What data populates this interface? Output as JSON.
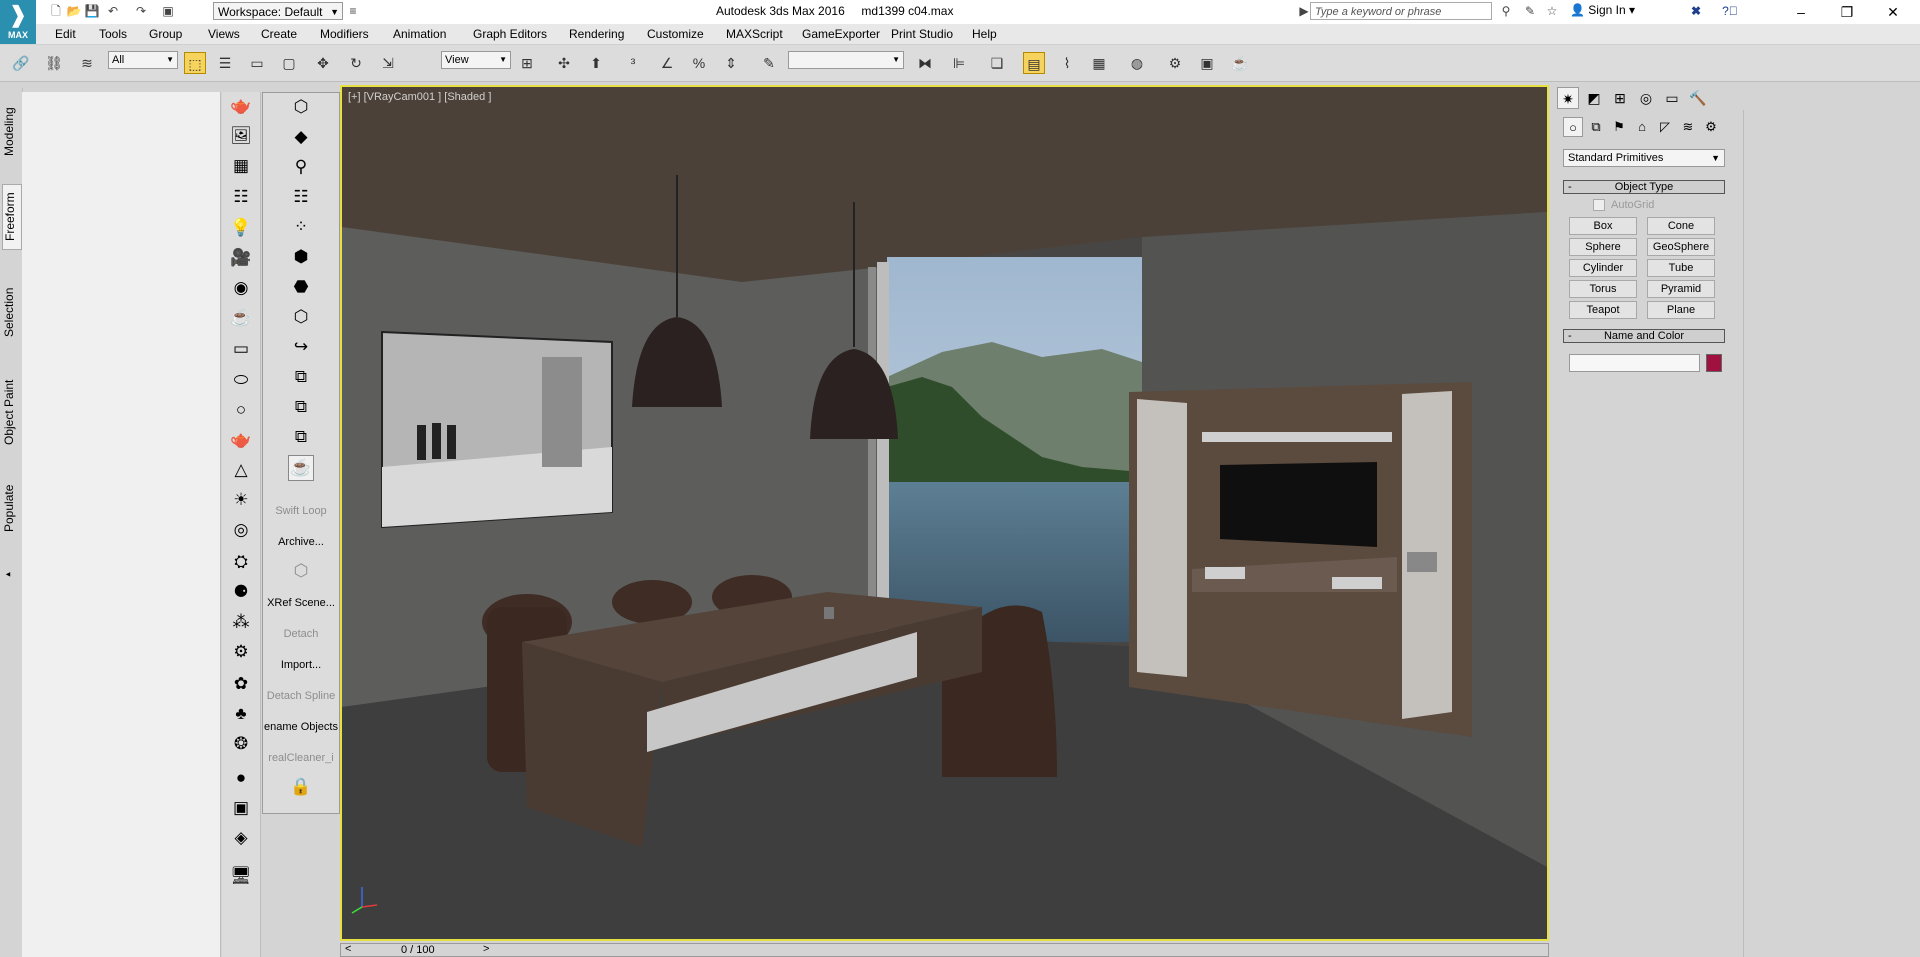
{
  "app": {
    "logo_text": "MAX",
    "workspace": "Workspace: Default",
    "title": "Autodesk 3ds Max 2016",
    "filename": "md1399 c04.max",
    "search_placeholder": "Type a keyword or phrase",
    "sign_in": "Sign In"
  },
  "menu": [
    "Edit",
    "Tools",
    "Group",
    "Views",
    "Create",
    "Modifiers",
    "Animation",
    "Graph Editors",
    "Rendering",
    "Customize",
    "MAXScript",
    "GameExporter",
    "Print Studio",
    "Help"
  ],
  "toolbar": {
    "selection_filter": "All",
    "reference_coord": "View",
    "named_selection": ""
  },
  "ribbon_tabs": [
    "Modeling",
    "Freeform",
    "Selection",
    "Object Paint",
    "Populate"
  ],
  "script_buttons": [
    {
      "label": "Swift Loop",
      "disabled": true
    },
    {
      "label": "Archive...",
      "disabled": false
    },
    {
      "label": "XRef Scene...",
      "disabled": false
    },
    {
      "label": "Detach",
      "disabled": true
    },
    {
      "label": "Import...",
      "disabled": false
    },
    {
      "label": "Detach Spline",
      "disabled": true
    },
    {
      "label": "ename Objects",
      "disabled": false
    },
    {
      "label": "realCleaner_i",
      "disabled": true
    }
  ],
  "viewport": {
    "label": "[+] [VRayCam001 ] [Shaded ]"
  },
  "timeline": {
    "position": "0 / 100",
    "left_arrow": "<",
    "right_arrow": ">"
  },
  "command_panel": {
    "category": "Standard Primitives",
    "object_type_title": "Object Type",
    "autogrid": "AutoGrid",
    "primitives": [
      "Box",
      "Cone",
      "Sphere",
      "GeoSphere",
      "Cylinder",
      "Tube",
      "Torus",
      "Pyramid",
      "Teapot",
      "Plane"
    ],
    "name_color_title": "Name and Color",
    "object_name": "",
    "object_color": "#a0113f"
  },
  "colors": {
    "viewport_border": "#e6e040",
    "active_button": "#f6d35c",
    "logo": "#2b8fb0"
  }
}
